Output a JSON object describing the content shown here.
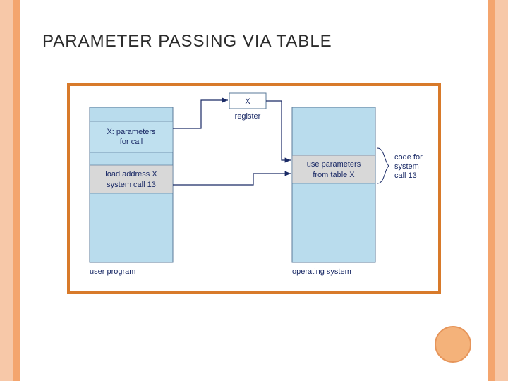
{
  "title": "PARAMETER PASSING VIA TABLE",
  "diagram": {
    "register_box": "X",
    "register_label": "register",
    "user_box_line1": "X: parameters",
    "user_box_line2": "for call",
    "user_call_line1": "load address X",
    "user_call_line2": "system call 13",
    "os_box_line1": "use parameters",
    "os_box_line2": "from table X",
    "user_caption": "user program",
    "os_caption": "operating system",
    "side_label_line1": "code for",
    "side_label_line2": "system",
    "side_label_line3": "call 13"
  },
  "chart_data": {
    "type": "table",
    "description": "Block diagram showing parameter passing via table from user program to operating system",
    "blocks": [
      {
        "id": "user_program",
        "label": "user program",
        "contents": [
          "X: parameters for call",
          "load address X",
          "system call 13"
        ]
      },
      {
        "id": "register",
        "label": "register",
        "contents": [
          "X"
        ]
      },
      {
        "id": "operating_system",
        "label": "operating system",
        "contents": [
          "use parameters from table X",
          "code for system call 13"
        ]
      }
    ],
    "arrows": [
      {
        "from": "user_program:X_parameters",
        "to": "register:X"
      },
      {
        "from": "register:X",
        "to": "operating_system:use_parameters"
      },
      {
        "from": "user_program:system_call_13",
        "to": "operating_system:use_parameters"
      }
    ]
  }
}
